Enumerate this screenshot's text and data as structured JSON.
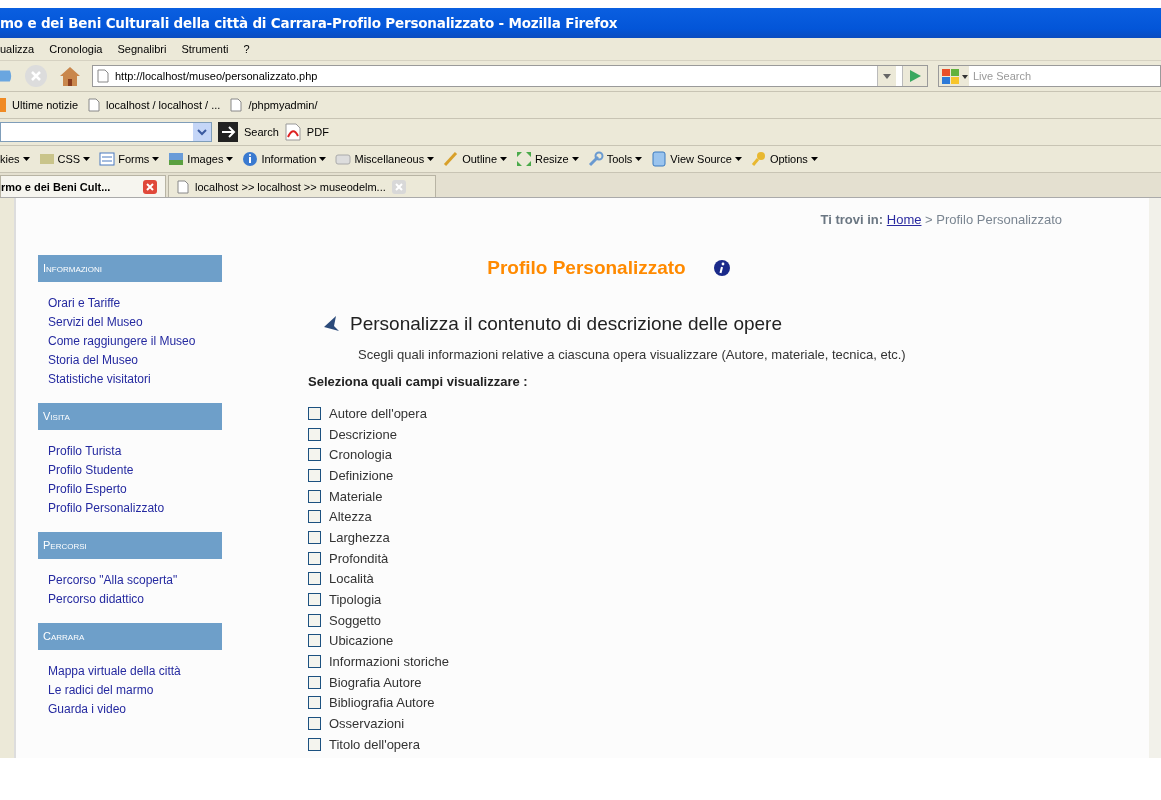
{
  "window": {
    "title": "mo e dei Beni Culturali della città di Carrara-Profilo Personalizzato - Mozilla Firefox"
  },
  "menu": [
    "ualizza",
    "Cronologia",
    "Segnalibri",
    "Strumenti",
    "?"
  ],
  "address_bar": {
    "value": "http://localhost/museo/personalizzato.php"
  },
  "web_search": {
    "placeholder": "Live Search"
  },
  "bookmarks": [
    {
      "label": "Ultime notizie",
      "kind": "feed"
    },
    {
      "label": "localhost / localhost / ...",
      "kind": "page"
    },
    {
      "label": "/phpmyadmin/",
      "kind": "page"
    }
  ],
  "search_toolbar": {
    "search_label": "Search",
    "pdf_label": "PDF"
  },
  "developer_toolbar": [
    {
      "label": "kies",
      "kind": "none"
    },
    {
      "label": "CSS",
      "kind": "css"
    },
    {
      "label": "Forms",
      "kind": "forms"
    },
    {
      "label": "Images",
      "kind": "images"
    },
    {
      "label": "Information",
      "kind": "info"
    },
    {
      "label": "Miscellaneous",
      "kind": "misc"
    },
    {
      "label": "Outline",
      "kind": "outline"
    },
    {
      "label": "Resize",
      "kind": "resize"
    },
    {
      "label": "Tools",
      "kind": "tools"
    },
    {
      "label": "View Source",
      "kind": "source"
    },
    {
      "label": "Options",
      "kind": "options"
    }
  ],
  "tabs": [
    {
      "label": "rmo e dei Beni Cult...",
      "selected": true
    },
    {
      "label": "localhost >> localhost >> museodelm...",
      "selected": false
    }
  ],
  "breadcrumb": {
    "prefix": "Ti trovi in:",
    "home": "Home",
    "separator": ">",
    "current": "Profilo Personalizzato"
  },
  "sidebar": [
    {
      "heading": "Informazioni",
      "items": [
        "Orari e Tariffe",
        "Servizi del Museo",
        "Come raggiungere il Museo",
        "Storia del Museo",
        "Statistiche visitatori"
      ]
    },
    {
      "heading": "Visita",
      "items": [
        "Profilo Turista",
        "Profilo Studente",
        "Profilo Esperto",
        "Profilo Personalizzato"
      ]
    },
    {
      "heading": "Percorsi",
      "items": [
        "Percorso \"Alla scoperta\"",
        "Percorso didattico"
      ]
    },
    {
      "heading": "Carrara",
      "items": [
        "Mappa virtuale della città",
        "Le radici del marmo",
        "Guarda i video"
      ]
    }
  ],
  "page_title": "Profilo Personalizzato",
  "section_title": "Personalizza il contenuto di descrizione delle opere",
  "description": "Scegli quali informazioni relative a ciascuna opera visualizzare (Autore, materiale, tecnica, etc.)",
  "fields_label": "Seleziona quali campi visualizzare :",
  "fields": [
    {
      "label": "Autore dell'opera",
      "checked": false
    },
    {
      "label": "Descrizione",
      "checked": false
    },
    {
      "label": "Cronologia",
      "checked": false
    },
    {
      "label": "Definizione",
      "checked": false
    },
    {
      "label": "Materiale",
      "checked": false
    },
    {
      "label": "Altezza",
      "checked": false
    },
    {
      "label": "Larghezza",
      "checked": false
    },
    {
      "label": "Profondità",
      "checked": false
    },
    {
      "label": "Località",
      "checked": false
    },
    {
      "label": "Tipologia",
      "checked": false
    },
    {
      "label": "Soggetto",
      "checked": false
    },
    {
      "label": "Ubicazione",
      "checked": false
    },
    {
      "label": "Informazioni storiche",
      "checked": false
    },
    {
      "label": "Biografia Autore",
      "checked": false
    },
    {
      "label": "Bibliografia Autore",
      "checked": false
    },
    {
      "label": "Osservazioni",
      "checked": false
    },
    {
      "label": "Titolo dell'opera",
      "checked": false
    }
  ]
}
